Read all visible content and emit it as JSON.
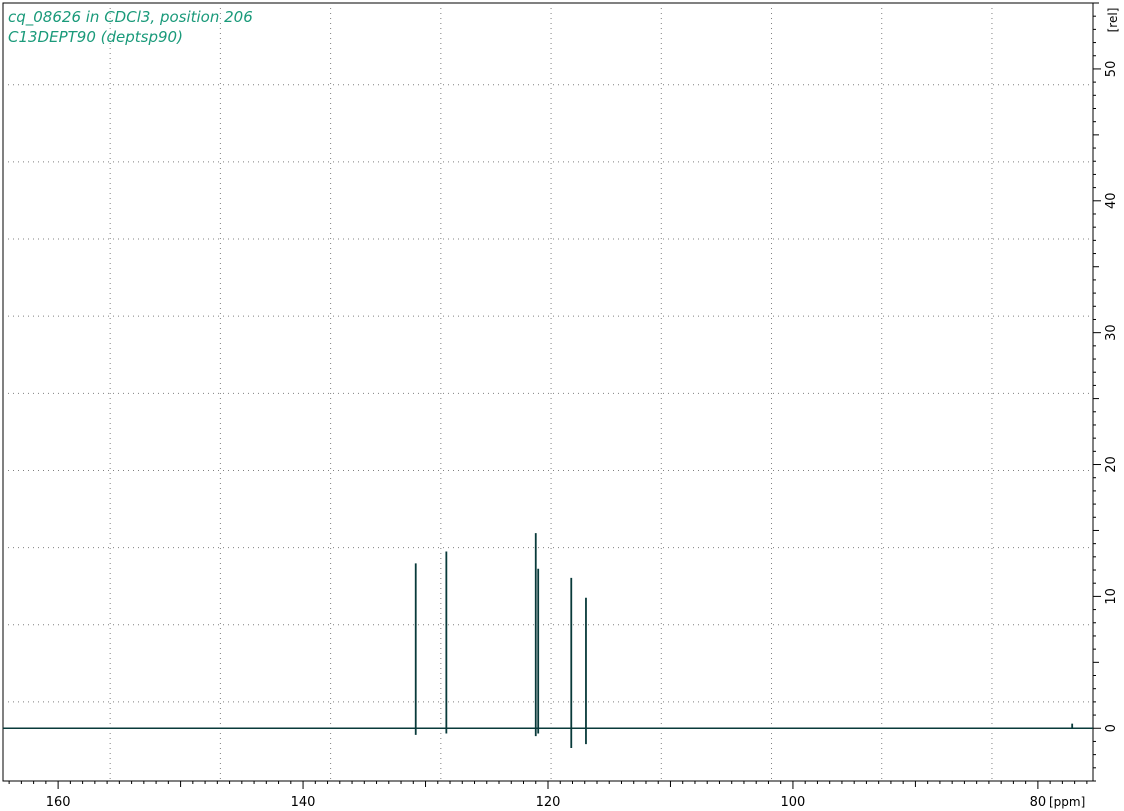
{
  "title_lines": [
    "cq_08626 in CDCl3, position 206",
    "C13DEPT90 (deptsp90)"
  ],
  "colors": {
    "spectrum": "#083a3a",
    "title": "#1a9a7a",
    "grid": "#808080",
    "frame": "#000000"
  },
  "chart_data": {
    "type": "line",
    "title": "cq_08626 in CDCl3, position 206",
    "subtitle": "C13DEPT90 (deptsp90)",
    "xlabel": "[ppm]",
    "ylabel": "[rel]",
    "xlim": [
      164.5,
      75.5
    ],
    "ylim": [
      -4,
      55
    ],
    "x_reversed": true,
    "grid": true,
    "x_tick_labels": [
      "160",
      "140",
      "120",
      "100",
      "80"
    ],
    "y_tick_labels": [
      "0",
      "10",
      "20",
      "30",
      "40",
      "50"
    ],
    "peaks": [
      {
        "ppm": 130.8,
        "height": 12.5,
        "dip": -0.5
      },
      {
        "ppm": 128.3,
        "height": 13.4,
        "dip": -0.4
      },
      {
        "ppm": 121.0,
        "height": 14.8,
        "dip": -0.6
      },
      {
        "ppm": 120.8,
        "height": 12.1,
        "dip": -0.4
      },
      {
        "ppm": 118.1,
        "height": 11.4,
        "dip": -1.5
      },
      {
        "ppm": 116.9,
        "height": 9.9,
        "dip": -1.2
      },
      {
        "ppm": 77.2,
        "height": 0.35,
        "dip": 0
      }
    ]
  }
}
